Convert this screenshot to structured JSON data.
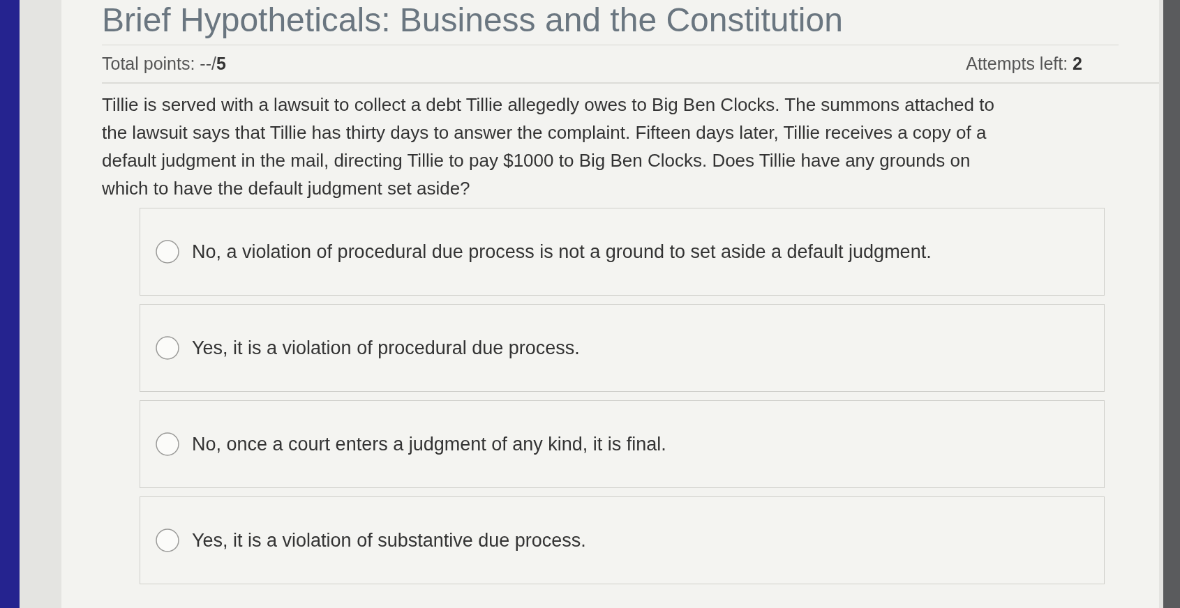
{
  "page": {
    "title": "Brief Hypotheticals: Business and the Constitution"
  },
  "header": {
    "total_points": "Total points: --/**5**",
    "attempts_left": "Attempts left: **2**"
  },
  "question": {
    "text": "Tillie is served with a lawsuit to collect a debt Tillie allegedly owes to Big Ben Clocks. The summons attached to the lawsuit says that Tillie has thirty days to answer the complaint. Fifteen days later, Tillie receives a copy of a default judgment in the mail, directing Tillie to pay $1000 to Big Ben Clocks. Does Tillie have any grounds on which to have the default judgment set aside?",
    "options": [
      {
        "label": "No, a violation of procedural due process is not a ground to set aside a default judgment.",
        "selected": false
      },
      {
        "label": "Yes, it is a violation of procedural due process.",
        "selected": false
      },
      {
        "label": "No, once a court enters a judgment of any kind, it is final.",
        "selected": false
      },
      {
        "label": "Yes, it is a violation of substantive due process.",
        "selected": false
      }
    ]
  }
}
